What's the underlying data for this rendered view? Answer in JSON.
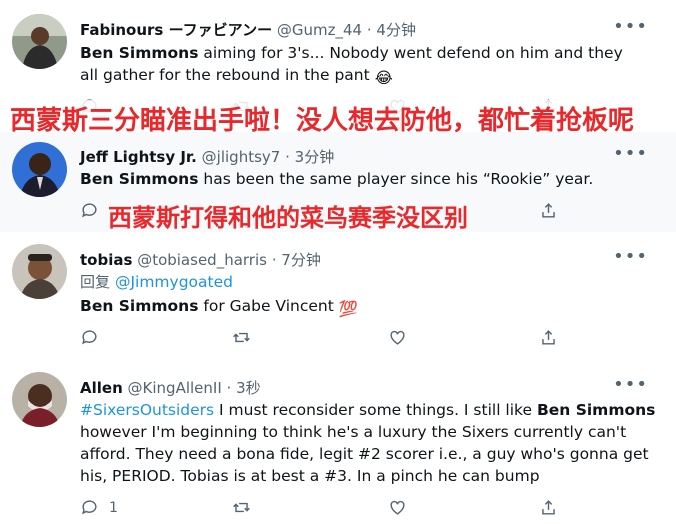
{
  "tweets": [
    {
      "name": "Fabinours ーファビアンー",
      "handle": "@Gumz_44",
      "dot": "·",
      "time": "4分钟",
      "text_strong": "Ben Simmons",
      "text_rest": " aiming for 3's... Nobody went defend on him and they all gather for the rebound in the pant",
      "emoji": "😂",
      "caption": "西蒙斯三分瞄准出手啦！没人想去防他，都忙着抢板呢"
    },
    {
      "name": "Jeff Lightsy Jr.",
      "handle": "@jlightsy7",
      "dot": "·",
      "time": "3分钟",
      "text_strong": "Ben Simmons",
      "text_rest": " has been the same player since his “Rookie” year.",
      "caption": "西蒙斯打得和他的菜鸟赛季没区别"
    },
    {
      "name": "tobias",
      "handle": "@tobiased_harris",
      "dot": "·",
      "time": "7分钟",
      "reply_prefix": "回复",
      "reply_to": "@Jimmygoated",
      "text_strong": "Ben Simmons",
      "text_rest": " for Gabe Vincent ",
      "emoji": "💯"
    },
    {
      "name": "Allen",
      "handle": "@KingAllenII",
      "dot": "·",
      "time": "3秒",
      "hashtag": "#SixersOutsiders",
      "text_a": "  I must reconsider some things. I still like ",
      "text_strong": "Ben Simmons",
      "text_b": " however I'm beginning to think he's a luxury the Sixers currently can't afford. They need a bona fide, legit #2 scorer i.e., a guy who's gonna get his, PERIOD. Tobias is at best a #3. In a pinch he can bump",
      "reply_count": "1"
    }
  ],
  "more_label": "•••"
}
